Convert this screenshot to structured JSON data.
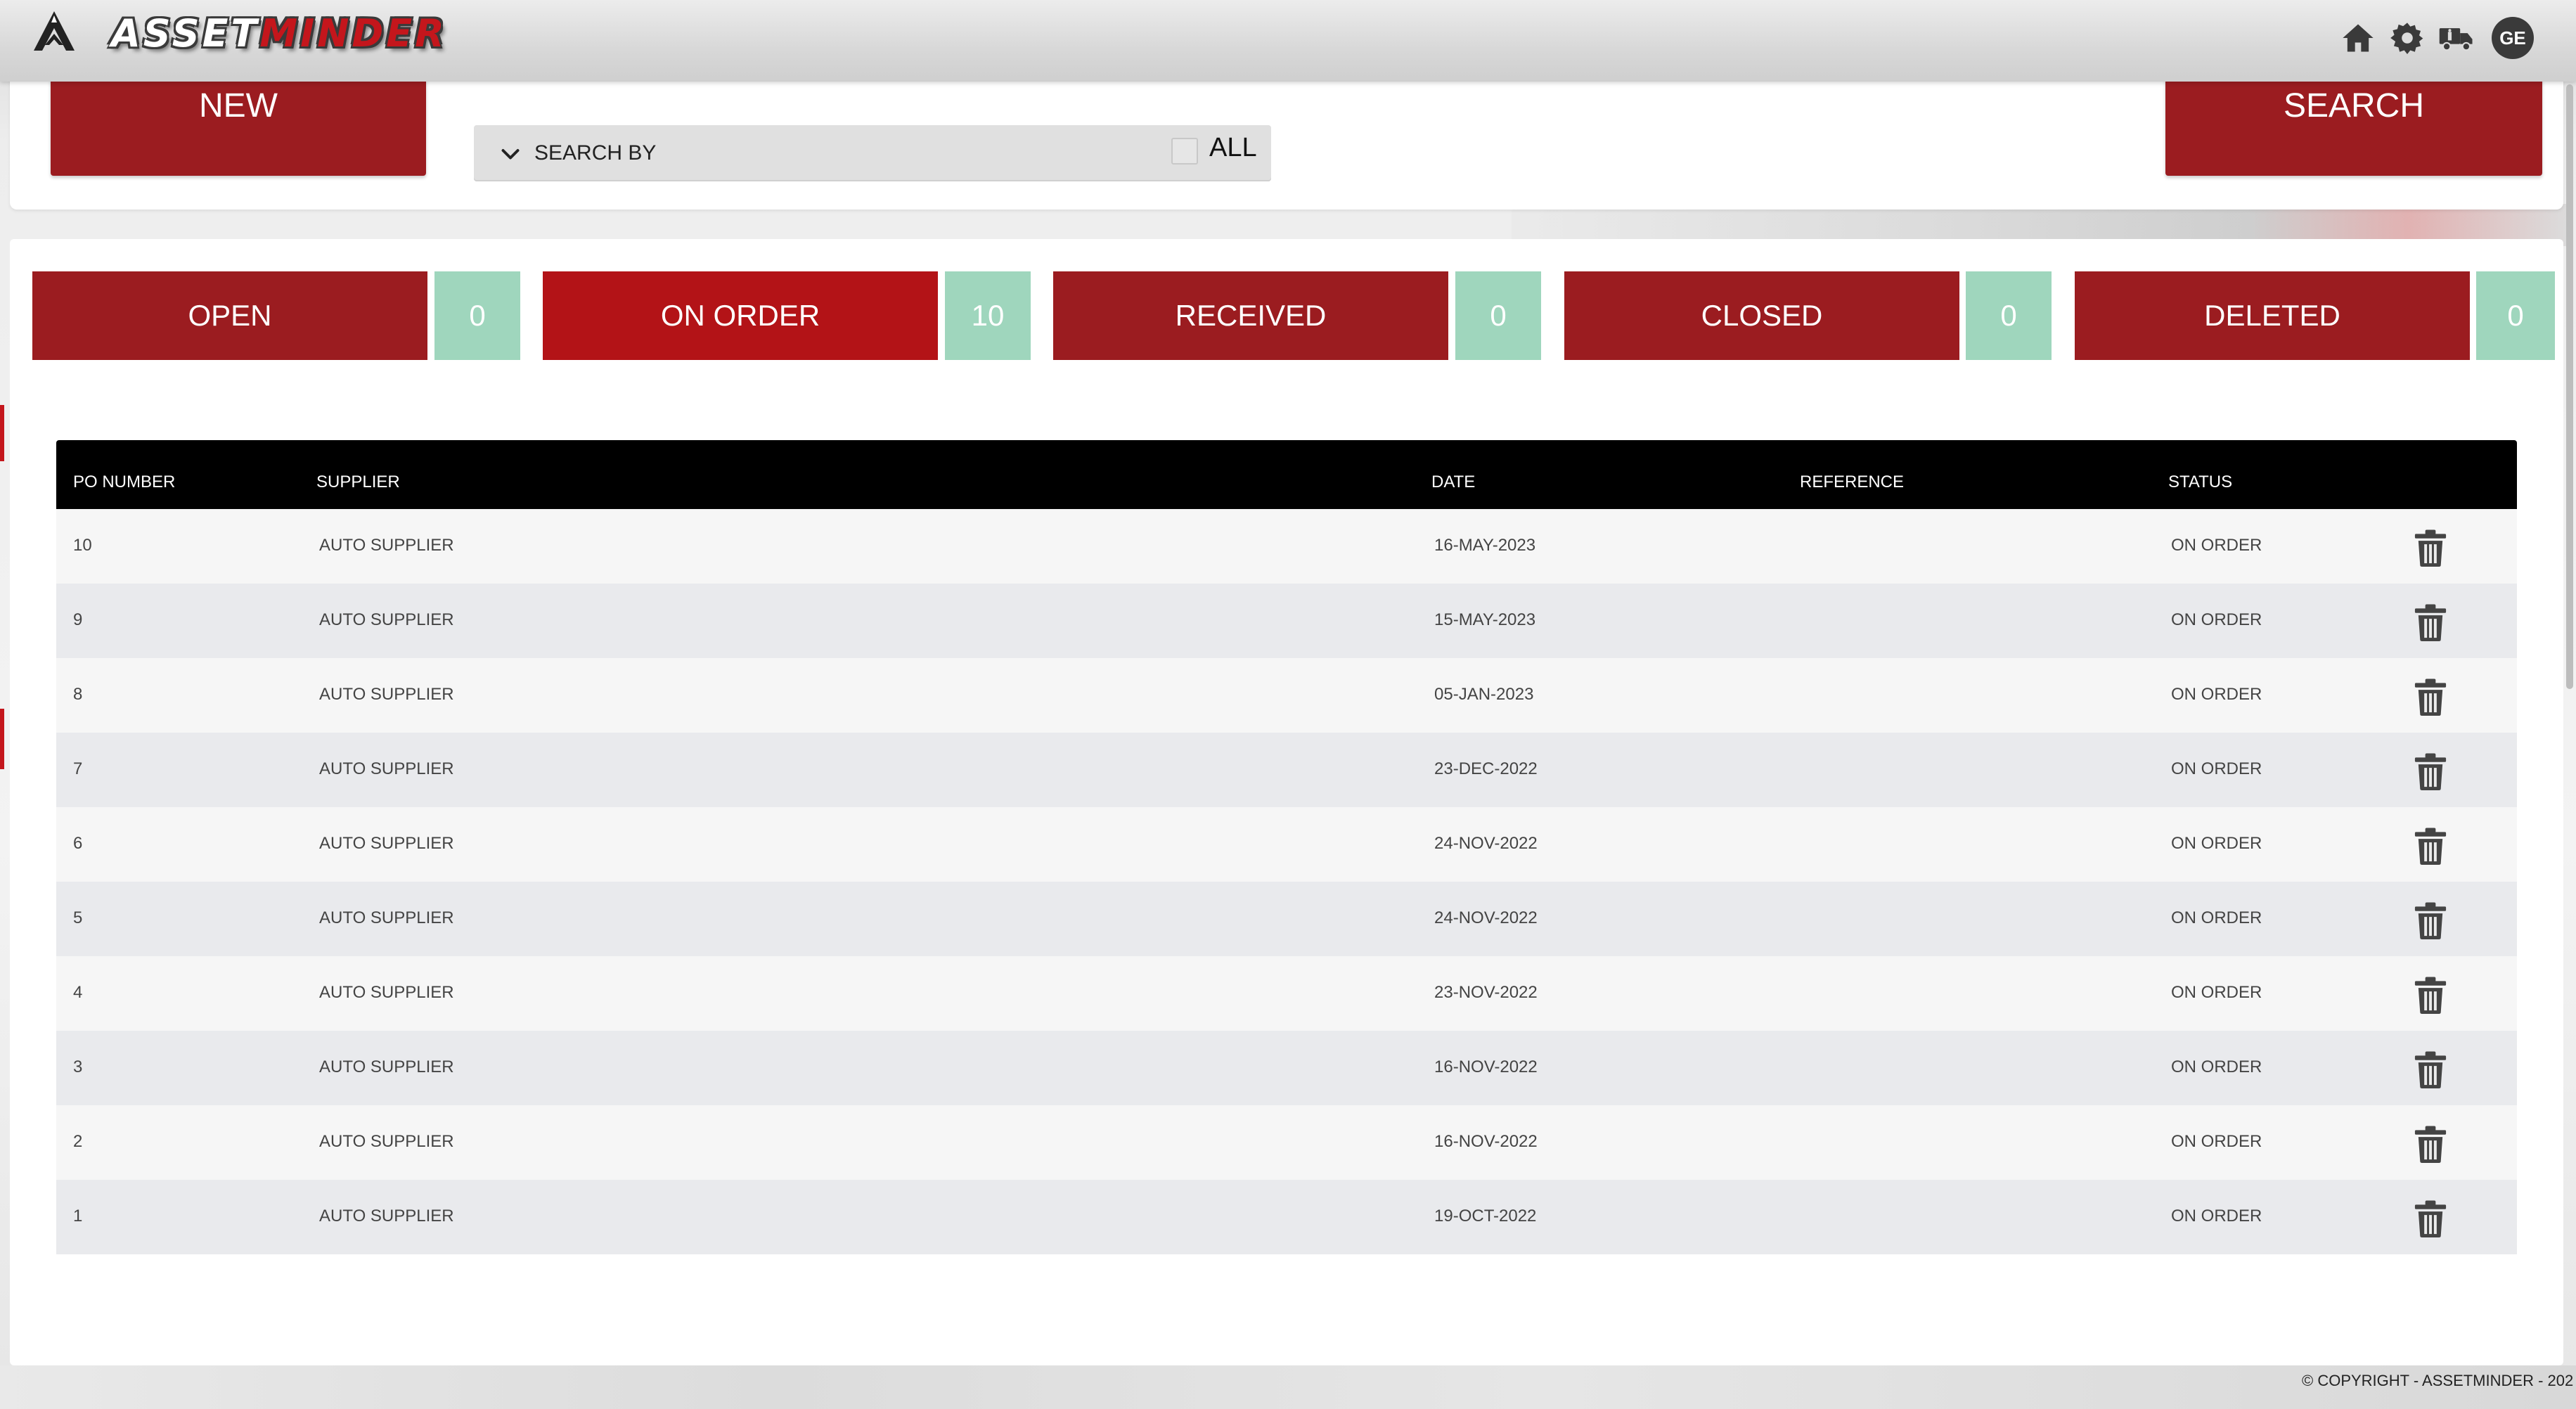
{
  "app": {
    "logo_prefix": "ASSET",
    "logo_suffix": "MINDER",
    "avatar_initials": "GE"
  },
  "toolbar": {
    "new_label": "NEW",
    "search_label": "SEARCH",
    "search_by_label": "SEARCH BY",
    "all_label": "ALL",
    "all_checked": false
  },
  "tabs": [
    {
      "label": "OPEN",
      "count": "0",
      "active": false
    },
    {
      "label": "ON ORDER",
      "count": "10",
      "active": true
    },
    {
      "label": "RECEIVED",
      "count": "0",
      "active": false
    },
    {
      "label": "CLOSED",
      "count": "0",
      "active": false
    },
    {
      "label": "DELETED",
      "count": "0",
      "active": false
    }
  ],
  "table": {
    "columns": [
      "PO NUMBER",
      "SUPPLIER",
      "DATE",
      "REFERENCE",
      "STATUS"
    ],
    "rows": [
      {
        "po": "10",
        "supplier": "AUTO SUPPLIER",
        "date": "16-MAY-2023",
        "reference": "",
        "status": "ON ORDER"
      },
      {
        "po": "9",
        "supplier": "AUTO SUPPLIER",
        "date": "15-MAY-2023",
        "reference": "",
        "status": "ON ORDER"
      },
      {
        "po": "8",
        "supplier": "AUTO SUPPLIER",
        "date": "05-JAN-2023",
        "reference": "",
        "status": "ON ORDER"
      },
      {
        "po": "7",
        "supplier": "AUTO SUPPLIER",
        "date": "23-DEC-2022",
        "reference": "",
        "status": "ON ORDER"
      },
      {
        "po": "6",
        "supplier": "AUTO SUPPLIER",
        "date": "24-NOV-2022",
        "reference": "",
        "status": "ON ORDER"
      },
      {
        "po": "5",
        "supplier": "AUTO SUPPLIER",
        "date": "24-NOV-2022",
        "reference": "",
        "status": "ON ORDER"
      },
      {
        "po": "4",
        "supplier": "AUTO SUPPLIER",
        "date": "23-NOV-2022",
        "reference": "",
        "status": "ON ORDER"
      },
      {
        "po": "3",
        "supplier": "AUTO SUPPLIER",
        "date": "16-NOV-2022",
        "reference": "",
        "status": "ON ORDER"
      },
      {
        "po": "2",
        "supplier": "AUTO SUPPLIER",
        "date": "16-NOV-2022",
        "reference": "",
        "status": "ON ORDER"
      },
      {
        "po": "1",
        "supplier": "AUTO SUPPLIER",
        "date": "19-OCT-2022",
        "reference": "",
        "status": "ON ORDER"
      }
    ]
  },
  "footer": {
    "copyright": "© COPYRIGHT - ASSETMINDER - 202"
  },
  "icons": {
    "logo": "assetminder-logo-icon",
    "home": "home-icon",
    "settings": "gear-icon",
    "truck": "truck-icon",
    "row_action": "trash-icon",
    "dropdown": "chevron-down-icon"
  },
  "colors": {
    "brand_red": "#9b1c20",
    "active_tab_red": "#b31317",
    "count_green": "#9fd6bd",
    "header_black": "#000000"
  }
}
